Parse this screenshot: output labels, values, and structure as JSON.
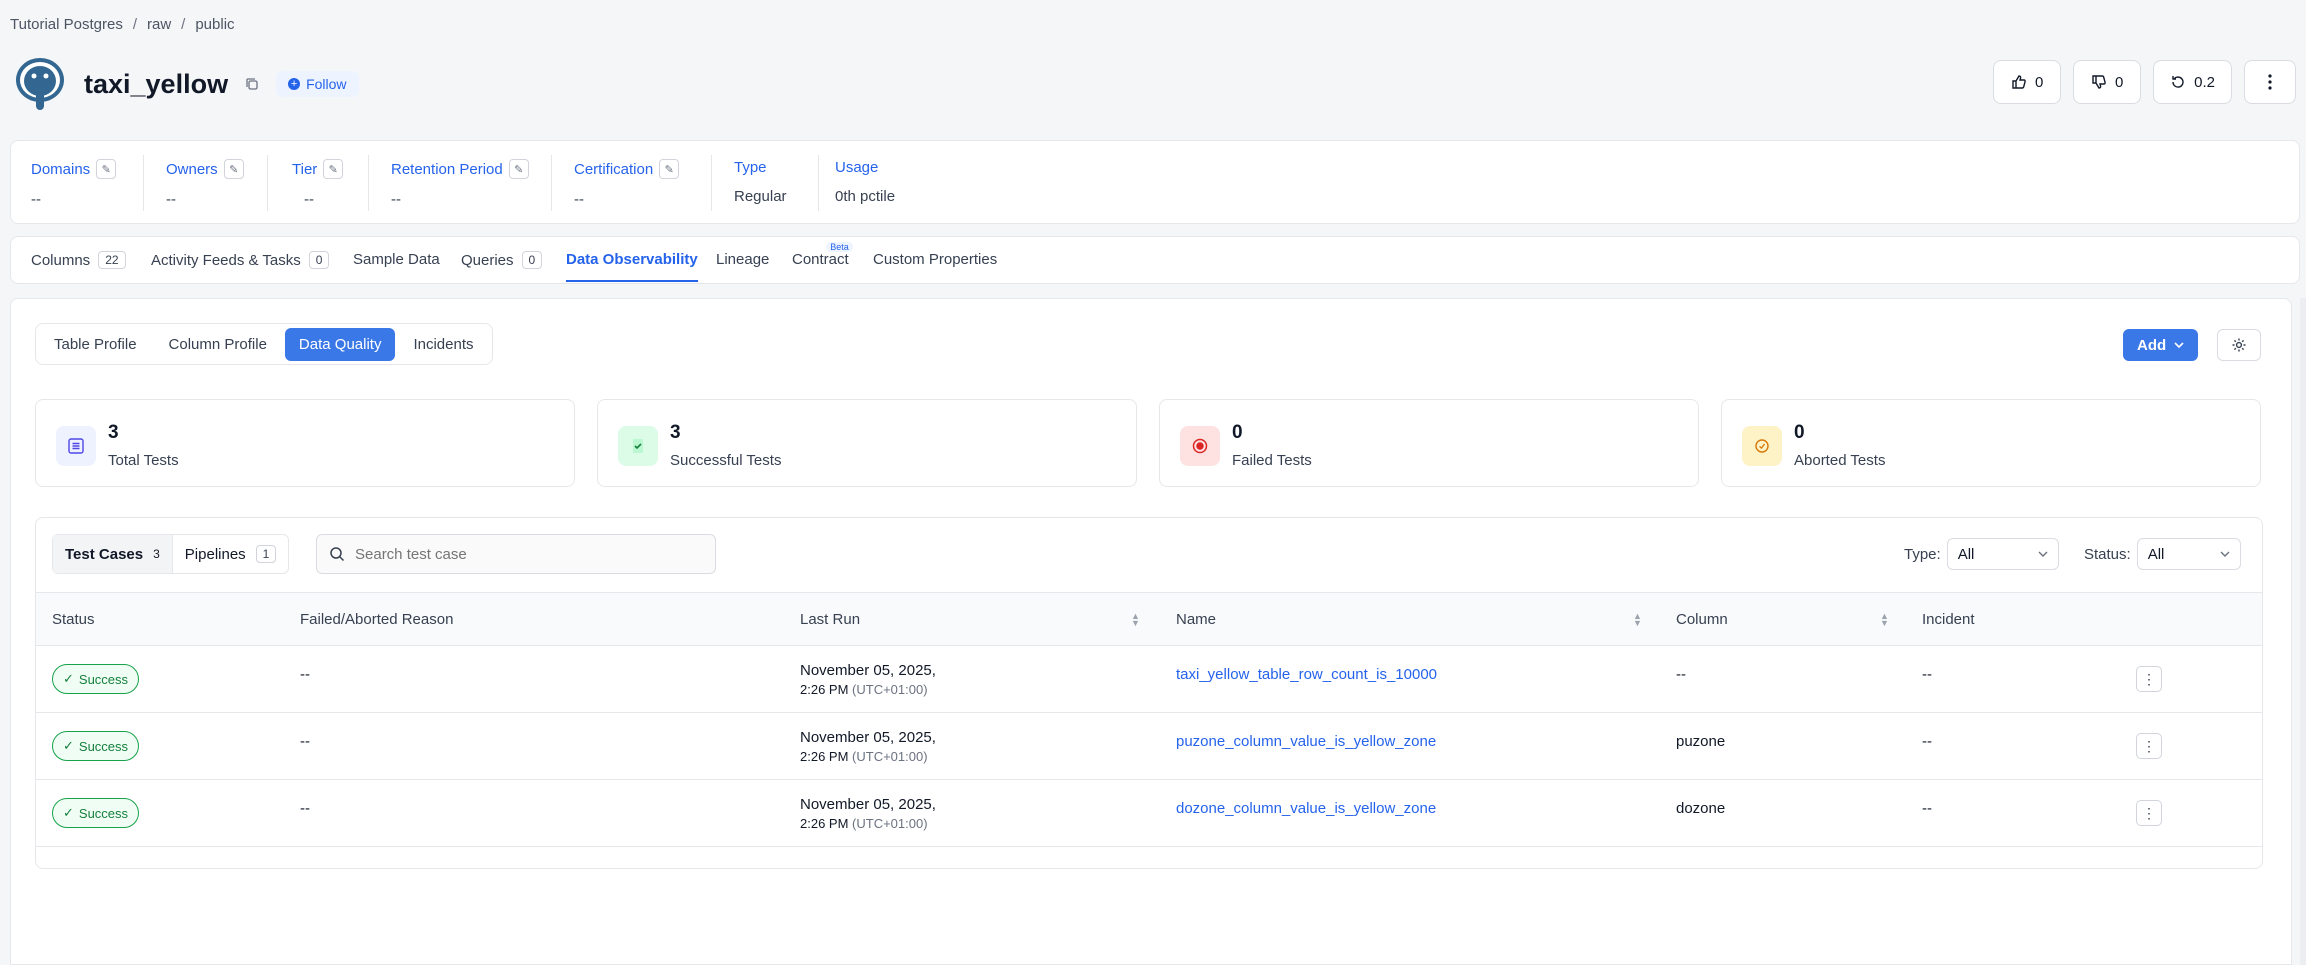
{
  "breadcrumb": [
    "Tutorial Postgres",
    "raw",
    "public"
  ],
  "header": {
    "title": "taxi_yellow",
    "follow_label": "Follow",
    "votes_up": "0",
    "votes_down": "0",
    "version": "0.2"
  },
  "meta": {
    "domains": {
      "label": "Domains",
      "value": "--"
    },
    "owners": {
      "label": "Owners",
      "value": "--"
    },
    "tier": {
      "label": "Tier",
      "value": "--"
    },
    "retention": {
      "label": "Retention Period",
      "value": "--"
    },
    "certification": {
      "label": "Certification",
      "value": "--"
    },
    "type": {
      "label": "Type",
      "value": "Regular"
    },
    "usage": {
      "label": "Usage",
      "value": "0th pctile"
    }
  },
  "tabs": {
    "columns": "Columns",
    "columns_count": "22",
    "activity": "Activity Feeds & Tasks",
    "activity_count": "0",
    "sample": "Sample Data",
    "queries": "Queries",
    "queries_count": "0",
    "observability": "Data Observability",
    "lineage": "Lineage",
    "contract": "Contract",
    "contract_badge": "Beta",
    "custom": "Custom Properties"
  },
  "subtabs": {
    "table_profile": "Table Profile",
    "column_profile": "Column Profile",
    "data_quality": "Data Quality",
    "incidents": "Incidents"
  },
  "actions": {
    "add": "Add"
  },
  "stats": {
    "total": {
      "value": "3",
      "label": "Total Tests"
    },
    "success": {
      "value": "3",
      "label": "Successful Tests"
    },
    "failed": {
      "value": "0",
      "label": "Failed Tests"
    },
    "aborted": {
      "value": "0",
      "label": "Aborted Tests"
    }
  },
  "test_panel": {
    "test_cases": "Test Cases",
    "test_cases_count": "3",
    "pipelines": "Pipelines",
    "pipelines_count": "1",
    "search_placeholder": "Search test case",
    "type_label": "Type:",
    "type_value": "All",
    "status_label": "Status:",
    "status_value": "All"
  },
  "table": {
    "headers": {
      "status": "Status",
      "reason": "Failed/Aborted Reason",
      "last_run": "Last Run",
      "name": "Name",
      "column": "Column",
      "incident": "Incident"
    },
    "rows": [
      {
        "status": "Success",
        "reason": "--",
        "date": "November 05, 2025,",
        "time": "2:26 PM",
        "tz": "(UTC+01:00)",
        "name": "taxi_yellow_table_row_count_is_10000",
        "column": "--",
        "incident": "--"
      },
      {
        "status": "Success",
        "reason": "--",
        "date": "November 05, 2025,",
        "time": "2:26 PM",
        "tz": "(UTC+01:00)",
        "name": "puzone_column_value_is_yellow_zone",
        "column": "puzone",
        "incident": "--"
      },
      {
        "status": "Success",
        "reason": "--",
        "date": "November 05, 2025,",
        "time": "2:26 PM",
        "tz": "(UTC+01:00)",
        "name": "dozone_column_value_is_yellow_zone",
        "column": "dozone",
        "incident": "--"
      }
    ]
  },
  "colors": {
    "accent": "#3b78e7",
    "link": "#2563eb",
    "success": "#15803d"
  }
}
